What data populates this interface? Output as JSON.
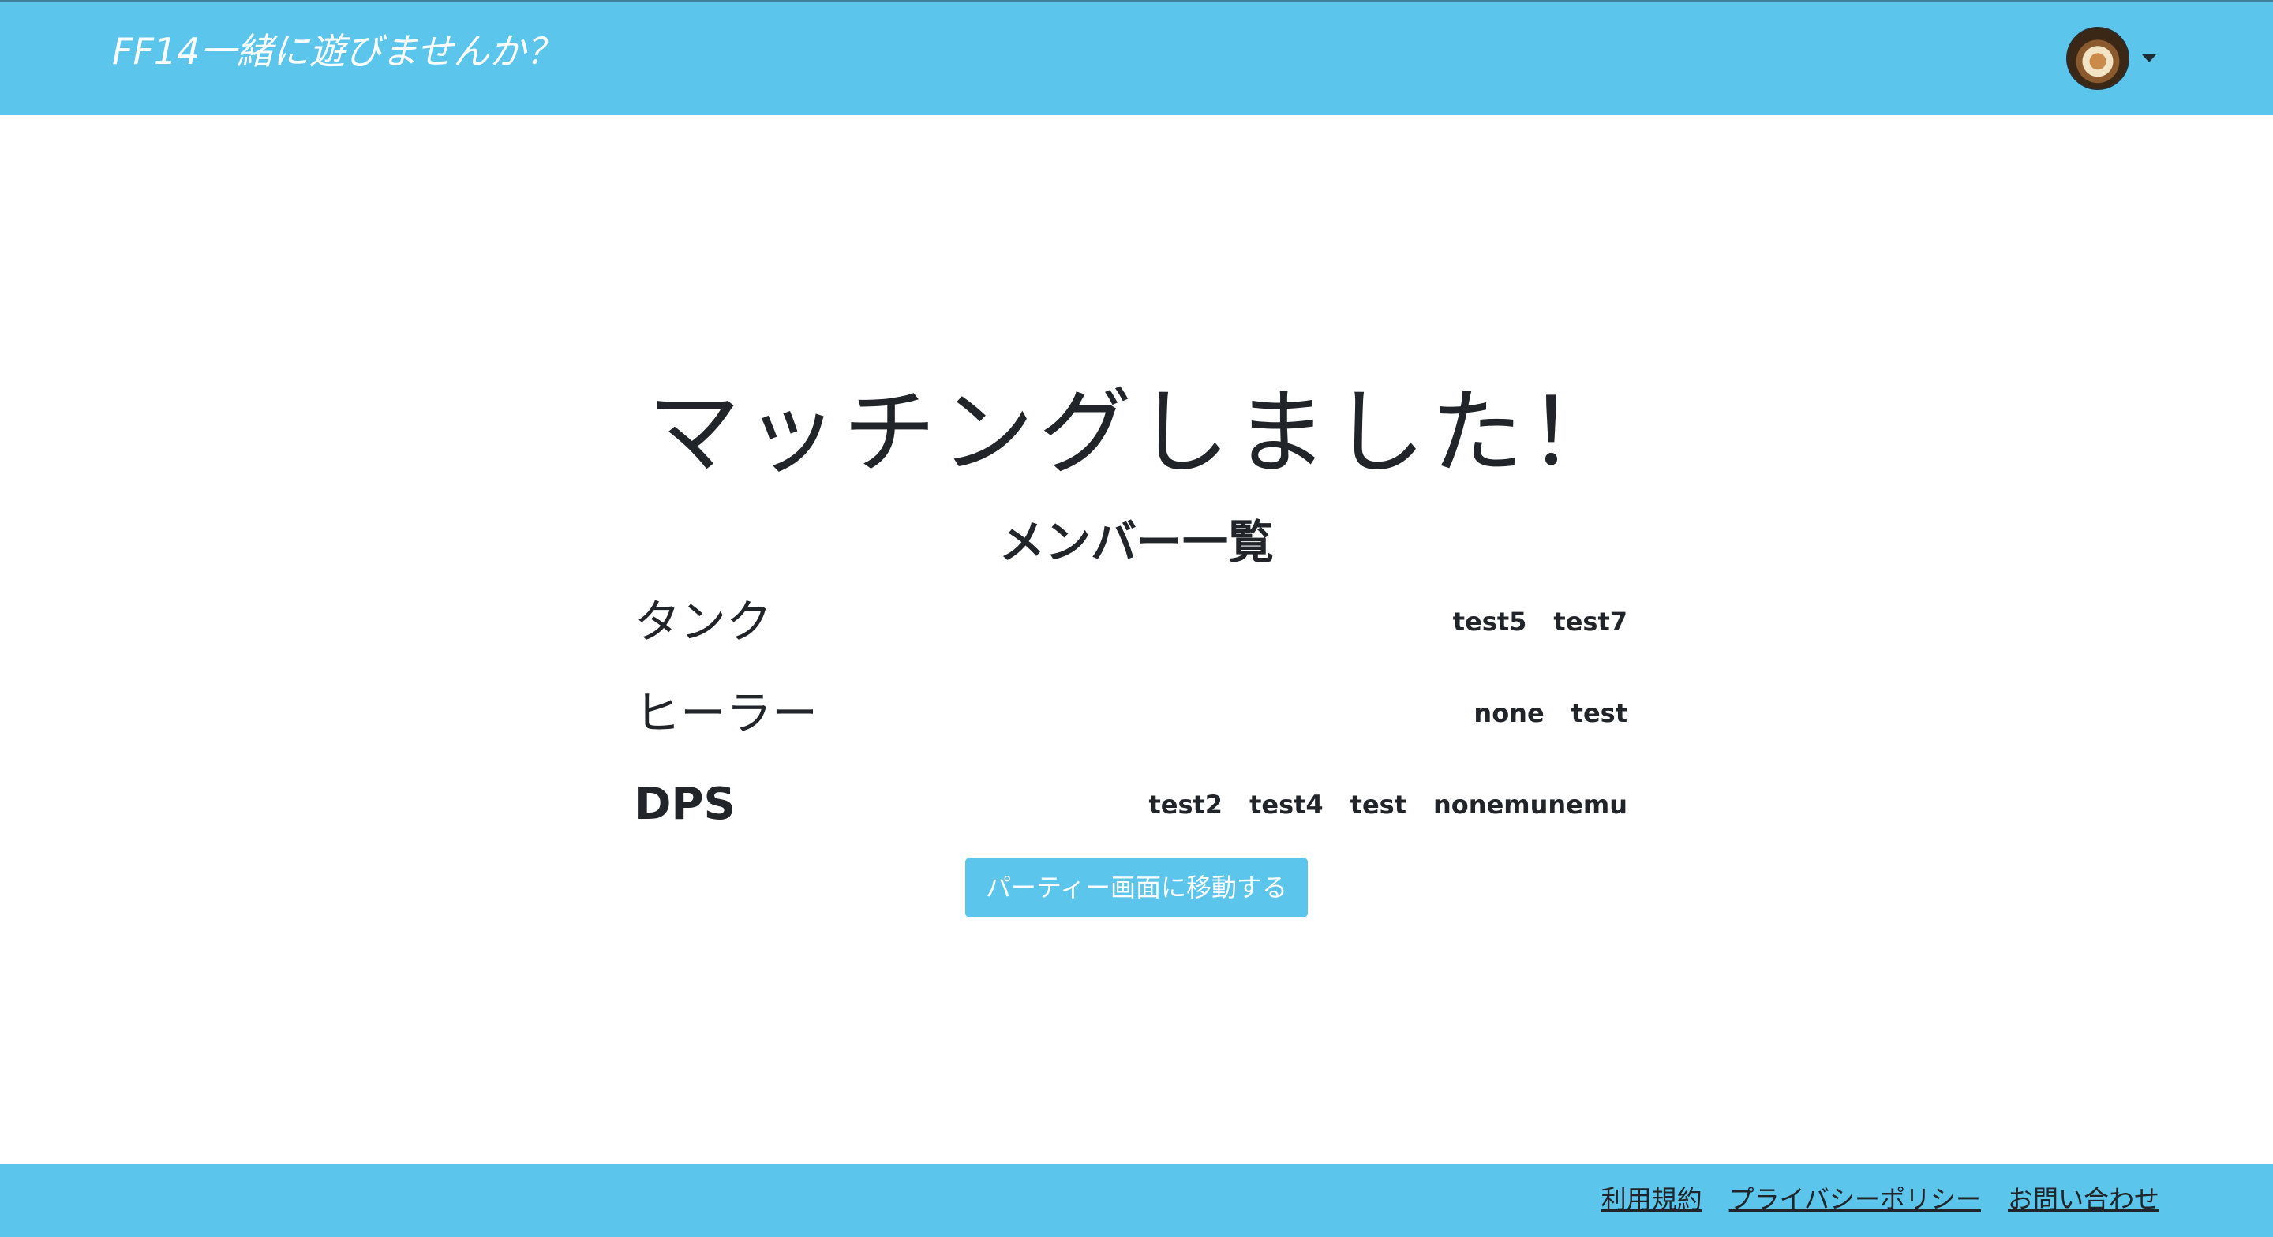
{
  "header": {
    "brand": "FF14一緒に遊びませんか？",
    "avatar_icon": "user-avatar",
    "dropdown_icon": "caret-down-icon"
  },
  "main": {
    "title": "マッチングしました！",
    "subtitle": "メンバー一覧",
    "roles": [
      {
        "name": "タンク",
        "members": [
          "test5",
          "test7"
        ]
      },
      {
        "name": "ヒーラー",
        "members": [
          "none",
          "test"
        ]
      },
      {
        "name": "DPS",
        "members": [
          "test2",
          "test4",
          "test",
          "nonemunemu"
        ]
      }
    ],
    "button_label": "パーティー画面に移動する"
  },
  "footer": {
    "links": [
      "利用規約",
      "プライバシーポリシー",
      "お問い合わせ"
    ]
  },
  "colors": {
    "accent": "#5bc5ec",
    "text": "#212529",
    "background": "#ffffff"
  }
}
